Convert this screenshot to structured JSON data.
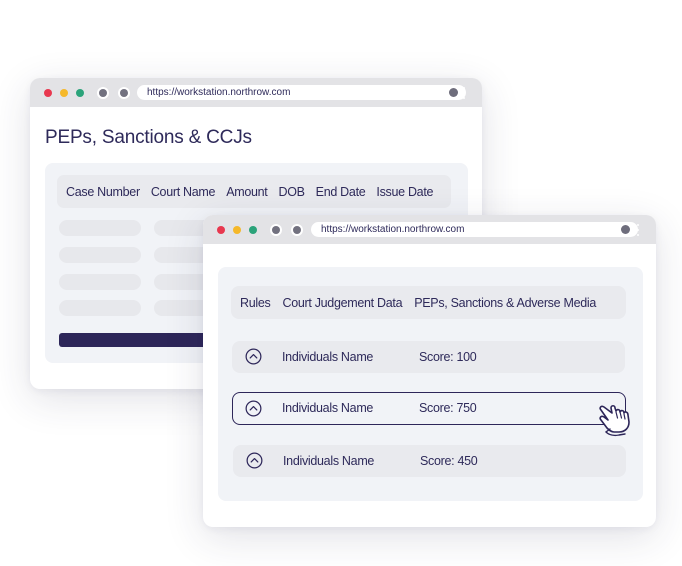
{
  "colors": {
    "accent": "#2d2659",
    "dot_red": "#e8384f",
    "dot_yellow": "#f5b82a",
    "dot_green": "#2ba37a",
    "panel_bg": "#f1f3f7",
    "row_bg": "#e9eaee"
  },
  "back_window": {
    "url": "https://workstation.northrow.com",
    "title": "PEPs, Sanctions & CCJs",
    "columns": [
      "Case Number",
      "Court Name",
      "Amount",
      "DOB",
      "End Date",
      "Issue Date"
    ],
    "icons": [
      "close-dot",
      "minimize-dot",
      "maximize-dot",
      "back-arrow-icon",
      "forward-arrow-icon",
      "search-icon",
      "more-vertical-icon"
    ]
  },
  "front_window": {
    "url": "https://workstation.northrow.com",
    "tabs": [
      "Rules",
      "Court Judgement Data",
      "PEPs, Sanctions & Adverse Media"
    ],
    "results": [
      {
        "name": "Individuals Name",
        "score": "Score: 100",
        "selected": false,
        "icon": "chevron-up-circle-icon"
      },
      {
        "name": "Individuals Name",
        "score": "Score: 750",
        "selected": true,
        "icon": "chevron-up-circle-icon"
      },
      {
        "name": "Individuals Name",
        "score": "Score: 450",
        "selected": false,
        "icon": "chevron-up-circle-icon"
      }
    ],
    "pointer": "hand-pointer-icon"
  }
}
